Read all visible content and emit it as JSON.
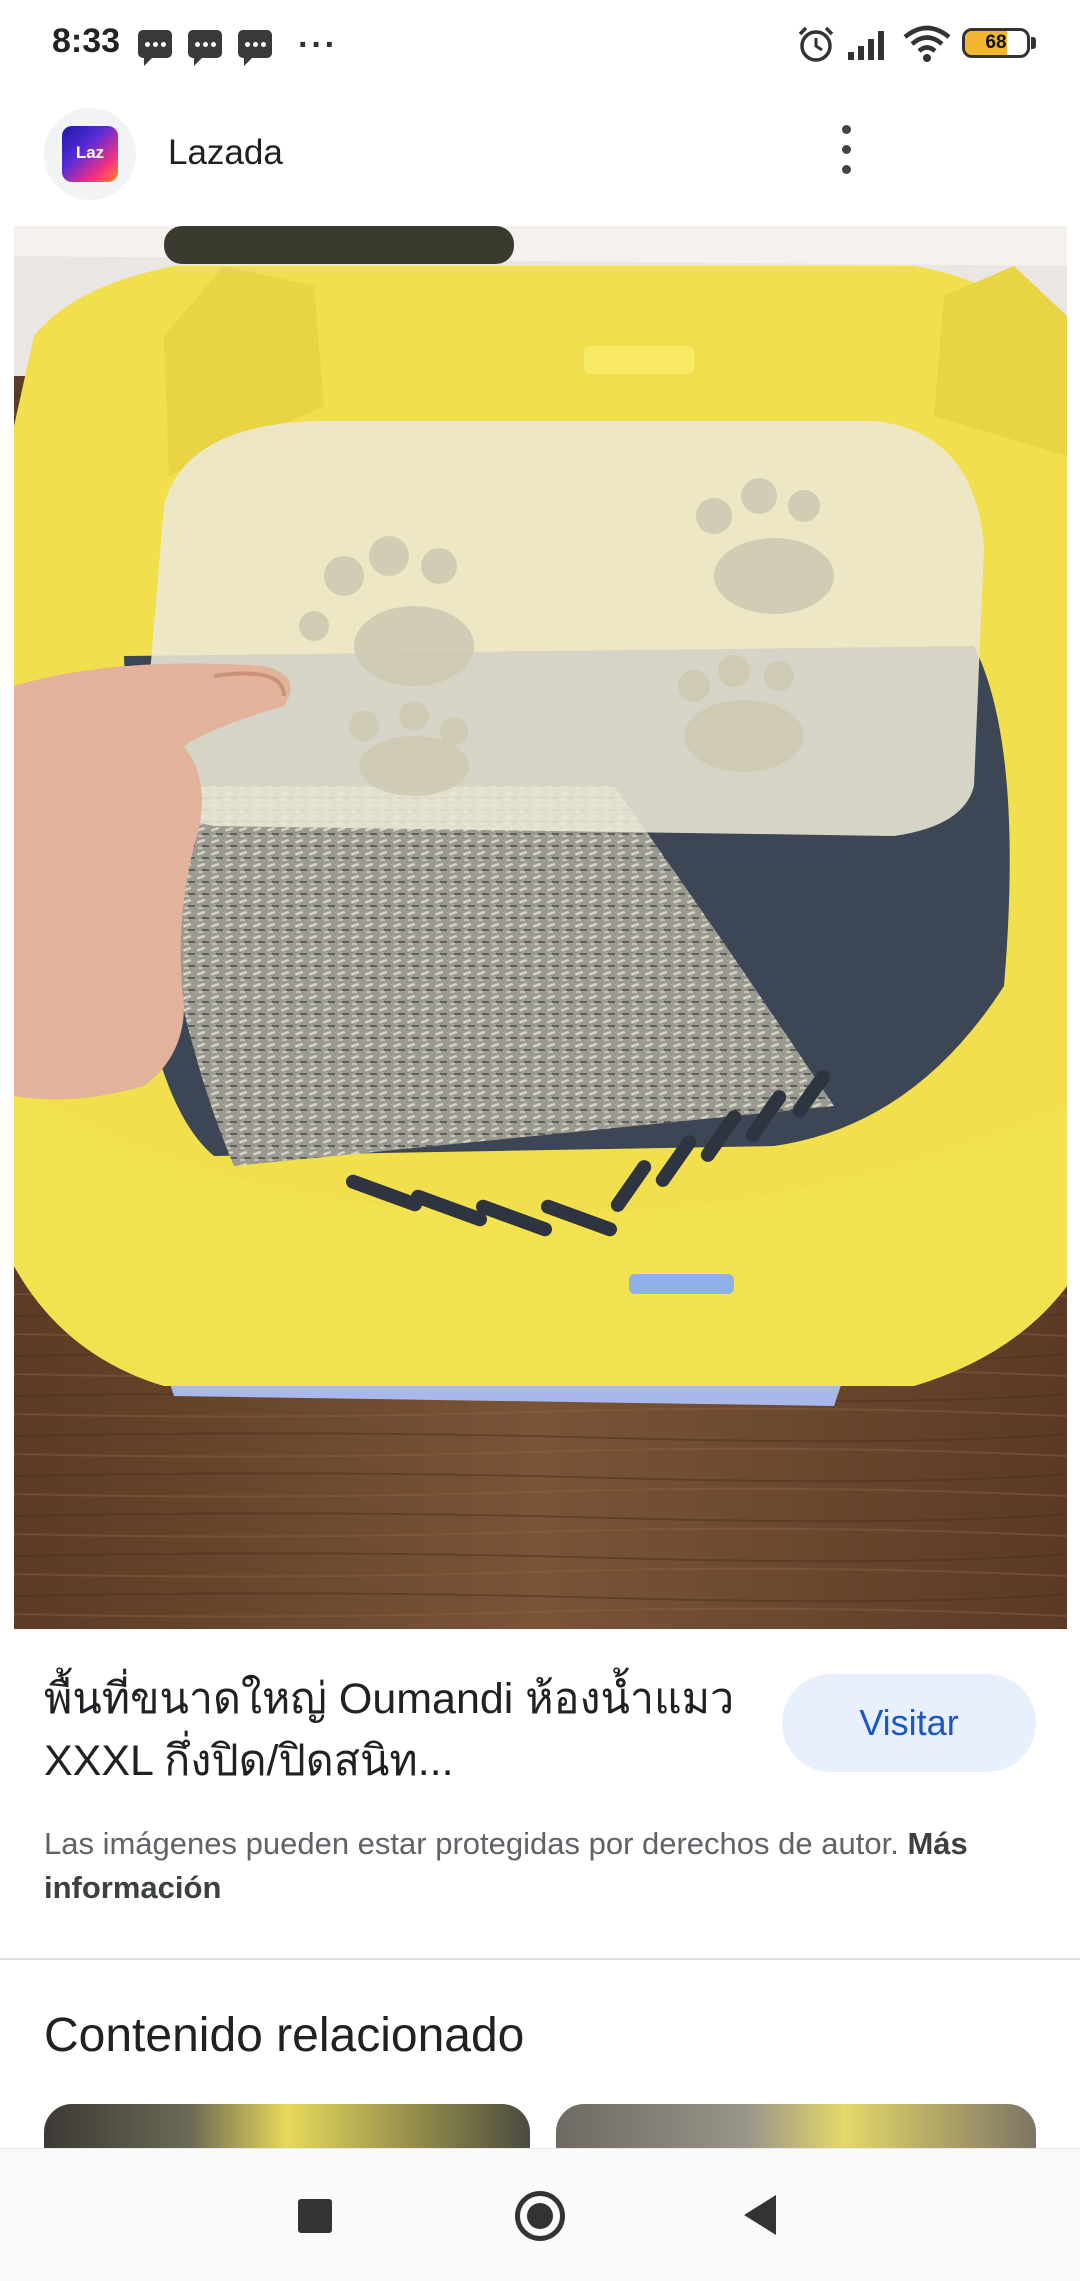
{
  "status_bar": {
    "time": "8:33",
    "more": "···",
    "battery": "68",
    "battery_level": 0.68,
    "icons": [
      "message-icon",
      "message-icon",
      "message-icon",
      "alarm-icon",
      "signal-icon",
      "wifi-icon",
      "battery-icon"
    ]
  },
  "header": {
    "logo_text": "Laz",
    "title": "Lazada",
    "menu_icon": "more-vert-icon"
  },
  "product": {
    "title": "พื้นที่ขนาดใหญ่ Oumandi ห้องน้ำแมว XXXL กึ่งปิด/ปิดสนิท...",
    "visit_label": "Visitar"
  },
  "copyright": {
    "text": "Las imágenes pueden estar protegidas por derechos de autor.",
    "link": "Más información"
  },
  "related": {
    "heading": "Contenido relacionado"
  },
  "nav": {
    "icons": [
      "recents-square-icon",
      "home-circle-icon",
      "back-triangle-icon"
    ]
  },
  "colors": {
    "accent": "#1a57c4",
    "button_bg": "#e8f0fe",
    "litter_box": "#f1df4e",
    "battery": "#f2b632"
  }
}
